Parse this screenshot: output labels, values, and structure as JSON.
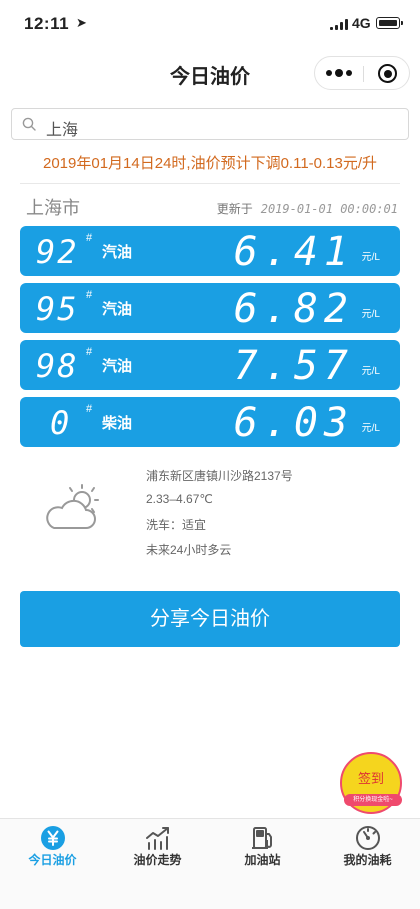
{
  "status_bar": {
    "time": "12:11",
    "network": "4G"
  },
  "header": {
    "title": "今日油价"
  },
  "search": {
    "value": "上海"
  },
  "notice": "2019年01月14日24时,油价预计下调0.11-0.13元/升",
  "city": {
    "name": "上海市",
    "updated_label": "更新于",
    "updated_time": "2019-01-01 00:00:01"
  },
  "prices": [
    {
      "grade": "92",
      "mark": "#",
      "fuel": "汽油",
      "price": "6.41",
      "unit": "元/L"
    },
    {
      "grade": "95",
      "mark": "#",
      "fuel": "汽油",
      "price": "6.82",
      "unit": "元/L"
    },
    {
      "grade": "98",
      "mark": "#",
      "fuel": "汽油",
      "price": "7.57",
      "unit": "元/L"
    },
    {
      "grade": "0",
      "mark": "#",
      "fuel": "柴油",
      "price": "6.03",
      "unit": "元/L"
    }
  ],
  "weather": {
    "icon": "cloud-sun-icon",
    "address": "浦东新区唐镇川沙路2137号",
    "temperature": "2.33–4.67℃",
    "car_wash": "洗车：适宜",
    "forecast": "未来24小时多云"
  },
  "share_button": "分享今日油价",
  "checkin": {
    "label": "签到",
    "ribbon": "积分换现金啦~"
  },
  "tabs": [
    {
      "label": "今日油价",
      "icon": "yen-icon",
      "active": true
    },
    {
      "label": "油价走势",
      "icon": "trend-chart-icon",
      "active": false
    },
    {
      "label": "加油站",
      "icon": "gas-station-icon",
      "active": false
    },
    {
      "label": "我的油耗",
      "icon": "gauge-icon",
      "active": false
    }
  ],
  "colors": {
    "accent": "#1a9fe3",
    "notice": "#d2691e",
    "badge_yellow": "#f5d51e",
    "badge_pink": "#ef4a6d"
  }
}
